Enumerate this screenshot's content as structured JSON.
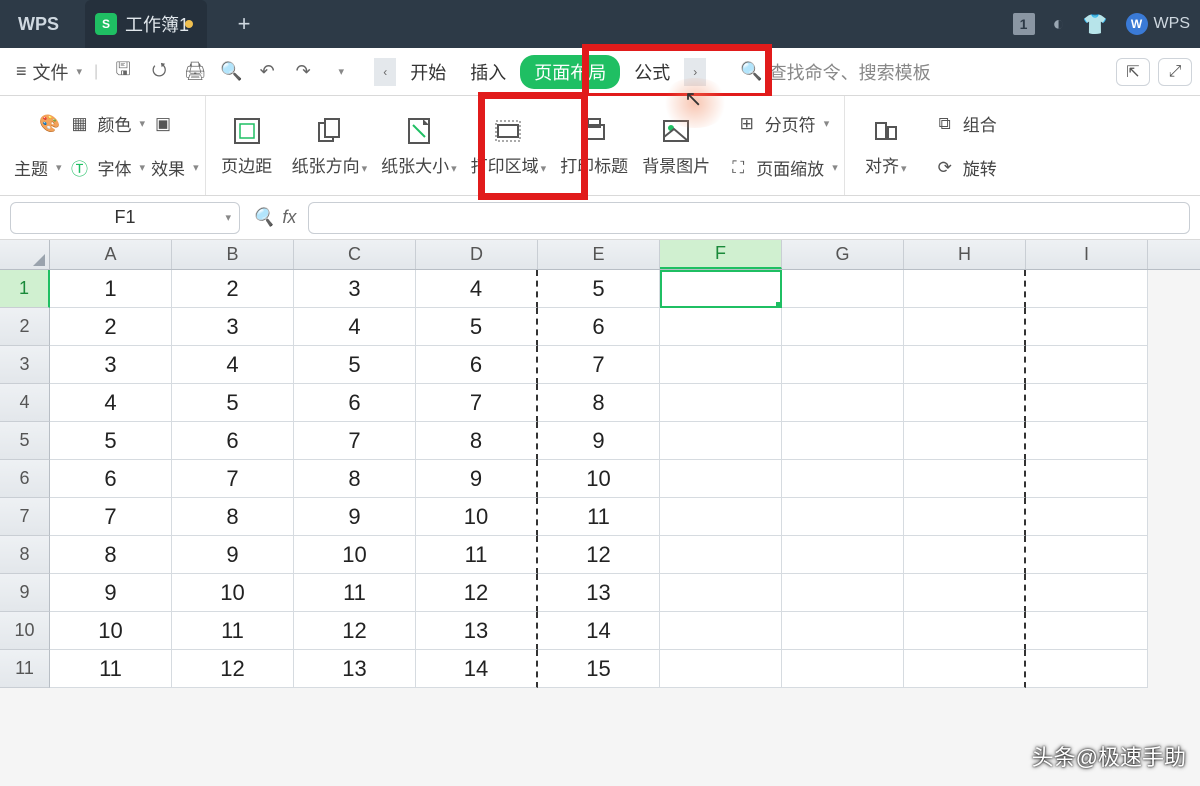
{
  "titlebar": {
    "app": "WPS",
    "doc_icon": "S",
    "doc_name": "工作簿1",
    "new_tab": "+",
    "badge": "1",
    "brand": "WPS"
  },
  "menubar": {
    "file": "文件",
    "tabs": {
      "start": "开始",
      "insert": "插入",
      "page_layout": "页面布局",
      "formula": "公式"
    },
    "search_placeholder": "查找命令、搜索模板"
  },
  "ribbon": {
    "theme": "主题",
    "colors": "颜色",
    "fonts": "字体",
    "effects": "效果",
    "margins": "页边距",
    "orientation": "纸张方向",
    "size": "纸张大小",
    "print_area": "打印区域",
    "print_titles": "打印标题",
    "background": "背景图片",
    "breaks": "分页符",
    "zoom": "页面缩放",
    "align": "对齐",
    "group": "组合",
    "rotate": "旋转"
  },
  "formula_bar": {
    "cell_ref": "F1",
    "fx": "fx"
  },
  "sheet": {
    "columns": [
      "A",
      "B",
      "C",
      "D",
      "E",
      "F",
      "G",
      "H",
      "I"
    ],
    "active_col": "F",
    "active_row": 1,
    "rows": [
      {
        "n": 1,
        "cells": [
          "1",
          "2",
          "3",
          "4",
          "5",
          "",
          "",
          "",
          ""
        ]
      },
      {
        "n": 2,
        "cells": [
          "2",
          "3",
          "4",
          "5",
          "6",
          "",
          "",
          "",
          ""
        ]
      },
      {
        "n": 3,
        "cells": [
          "3",
          "4",
          "5",
          "6",
          "7",
          "",
          "",
          "",
          ""
        ]
      },
      {
        "n": 4,
        "cells": [
          "4",
          "5",
          "6",
          "7",
          "8",
          "",
          "",
          "",
          ""
        ]
      },
      {
        "n": 5,
        "cells": [
          "5",
          "6",
          "7",
          "8",
          "9",
          "",
          "",
          "",
          ""
        ]
      },
      {
        "n": 6,
        "cells": [
          "6",
          "7",
          "8",
          "9",
          "10",
          "",
          "",
          "",
          ""
        ]
      },
      {
        "n": 7,
        "cells": [
          "7",
          "8",
          "9",
          "10",
          "11",
          "",
          "",
          "",
          ""
        ]
      },
      {
        "n": 8,
        "cells": [
          "8",
          "9",
          "10",
          "11",
          "12",
          "",
          "",
          "",
          ""
        ]
      },
      {
        "n": 9,
        "cells": [
          "9",
          "10",
          "11",
          "12",
          "13",
          "",
          "",
          "",
          ""
        ]
      },
      {
        "n": 10,
        "cells": [
          "10",
          "11",
          "12",
          "13",
          "14",
          "",
          "",
          "",
          ""
        ]
      },
      {
        "n": 11,
        "cells": [
          "11",
          "12",
          "13",
          "14",
          "15",
          "",
          "",
          "",
          ""
        ]
      }
    ],
    "page_break_after_cols": [
      "D",
      "H"
    ]
  },
  "watermark": "头条@极速手助"
}
